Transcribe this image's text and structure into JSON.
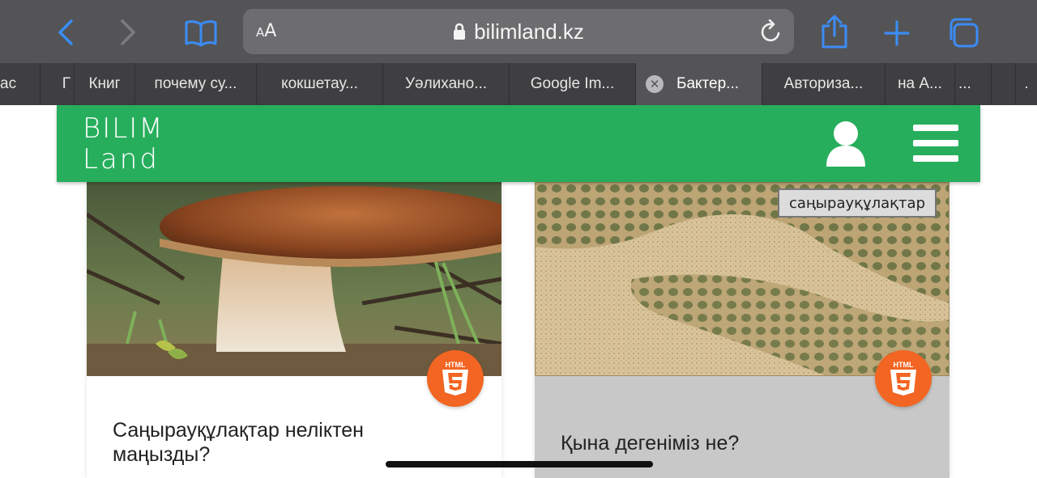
{
  "browser": {
    "text_size_label": "AA",
    "url": "bilimland.kz",
    "accent_color": "#3b8cf5"
  },
  "tabs": [
    {
      "label": "ас"
    },
    {
      "label": "Г"
    },
    {
      "label": "Книг"
    },
    {
      "label": "почему су..."
    },
    {
      "label": "кокшетау..."
    },
    {
      "label": "Уәлихано..."
    },
    {
      "label": "Google Im..."
    },
    {
      "label": "Бактер...",
      "active": true
    },
    {
      "label": "Авториза..."
    },
    {
      "label": "на А..."
    },
    {
      "label": "..."
    },
    {
      "label": ""
    },
    {
      "label": "."
    }
  ],
  "site": {
    "logo_line1": "BILIM",
    "logo_line2": "Land",
    "header_color": "#27ae5d",
    "user_icon": "user-icon",
    "menu_icon": "hamburger-menu-icon"
  },
  "cards": [
    {
      "title": "Саңырауқұлақтар неліктен маңызды?",
      "badge": "HTML",
      "image": "mushroom-photo"
    },
    {
      "title": "Қына дегеніміз не?",
      "badge": "HTML",
      "image": "lichen-micro-photo",
      "image_label": "саңырауқұлақтар"
    }
  ],
  "badge_color": "#f26522"
}
